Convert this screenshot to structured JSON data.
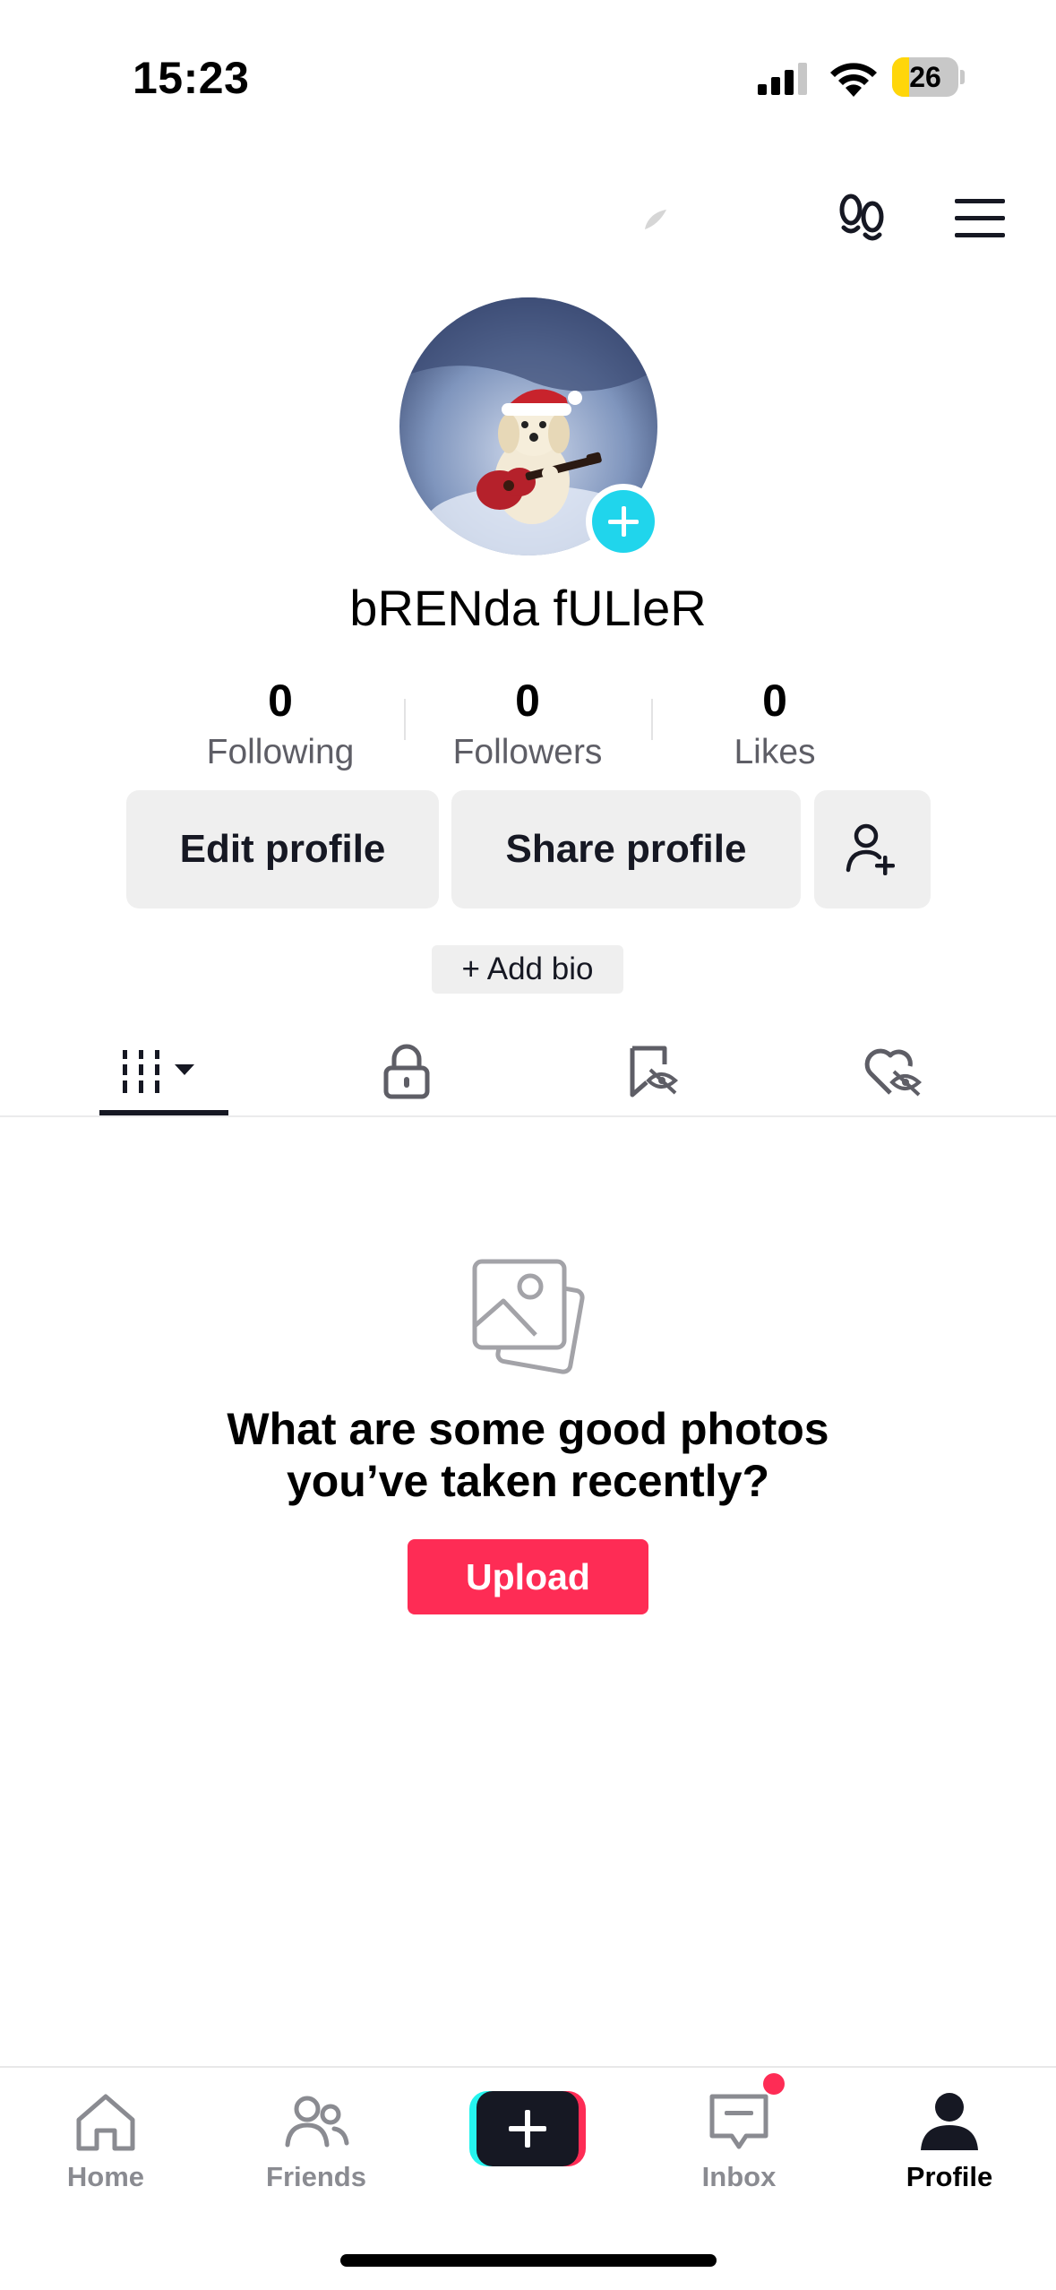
{
  "status_bar": {
    "time": "15:23",
    "battery_percent": "26",
    "battery_level": 0.26
  },
  "profile": {
    "username": "bRENda fULleR",
    "stats": [
      {
        "value": "0",
        "label": "Following"
      },
      {
        "value": "0",
        "label": "Followers"
      },
      {
        "value": "0",
        "label": "Likes"
      }
    ],
    "edit_label": "Edit profile",
    "share_label": "Share profile",
    "add_bio_label": "+ Add bio"
  },
  "tabs": [
    "posts-grid-icon",
    "lock-icon",
    "bookmark-hidden-icon",
    "heart-hidden-icon"
  ],
  "empty_state": {
    "title_line1": "What are some good photos",
    "title_line2": "you’ve taken recently?",
    "upload_label": "Upload"
  },
  "nav": {
    "home": "Home",
    "friends": "Friends",
    "inbox": "Inbox",
    "profile": "Profile"
  },
  "colors": {
    "accent": "#fe2c55",
    "cyan": "#25f4ee",
    "avatar_add": "#20d5ec"
  }
}
